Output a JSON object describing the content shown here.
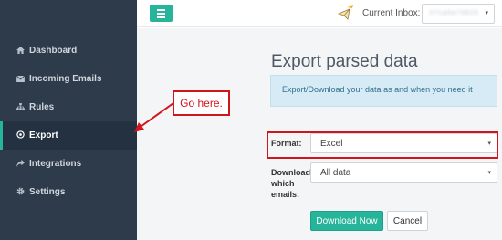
{
  "sidebar": {
    "items": [
      {
        "label": "Dashboard",
        "icon": "home-icon"
      },
      {
        "label": "Incoming Emails",
        "icon": "envelope-icon"
      },
      {
        "label": "Rules",
        "icon": "sitemap-icon"
      },
      {
        "label": "Export",
        "icon": "target-icon",
        "active": true
      },
      {
        "label": "Integrations",
        "icon": "share-icon"
      },
      {
        "label": "Settings",
        "icon": "gear-icon"
      }
    ]
  },
  "topbar": {
    "inbox_label": "Current Inbox:",
    "inbox_value": "h7ca5e74829",
    "inbox_caret": "▾"
  },
  "main": {
    "title": "Export parsed data",
    "alert": "Export/Download your data as and when you need it",
    "format_label": "Format:",
    "format_value": "Excel",
    "download_label": "Download which emails:",
    "download_value": "All data",
    "caret": "▾",
    "download_button": "Download Now",
    "cancel_button": "Cancel"
  },
  "annotation": {
    "callout_text": "Go here."
  },
  "colors": {
    "sidebar_bg": "#2d3b4a",
    "accent": "#26b59a",
    "annotation_red": "#d1151c",
    "alert_bg": "#d6ebf5"
  }
}
